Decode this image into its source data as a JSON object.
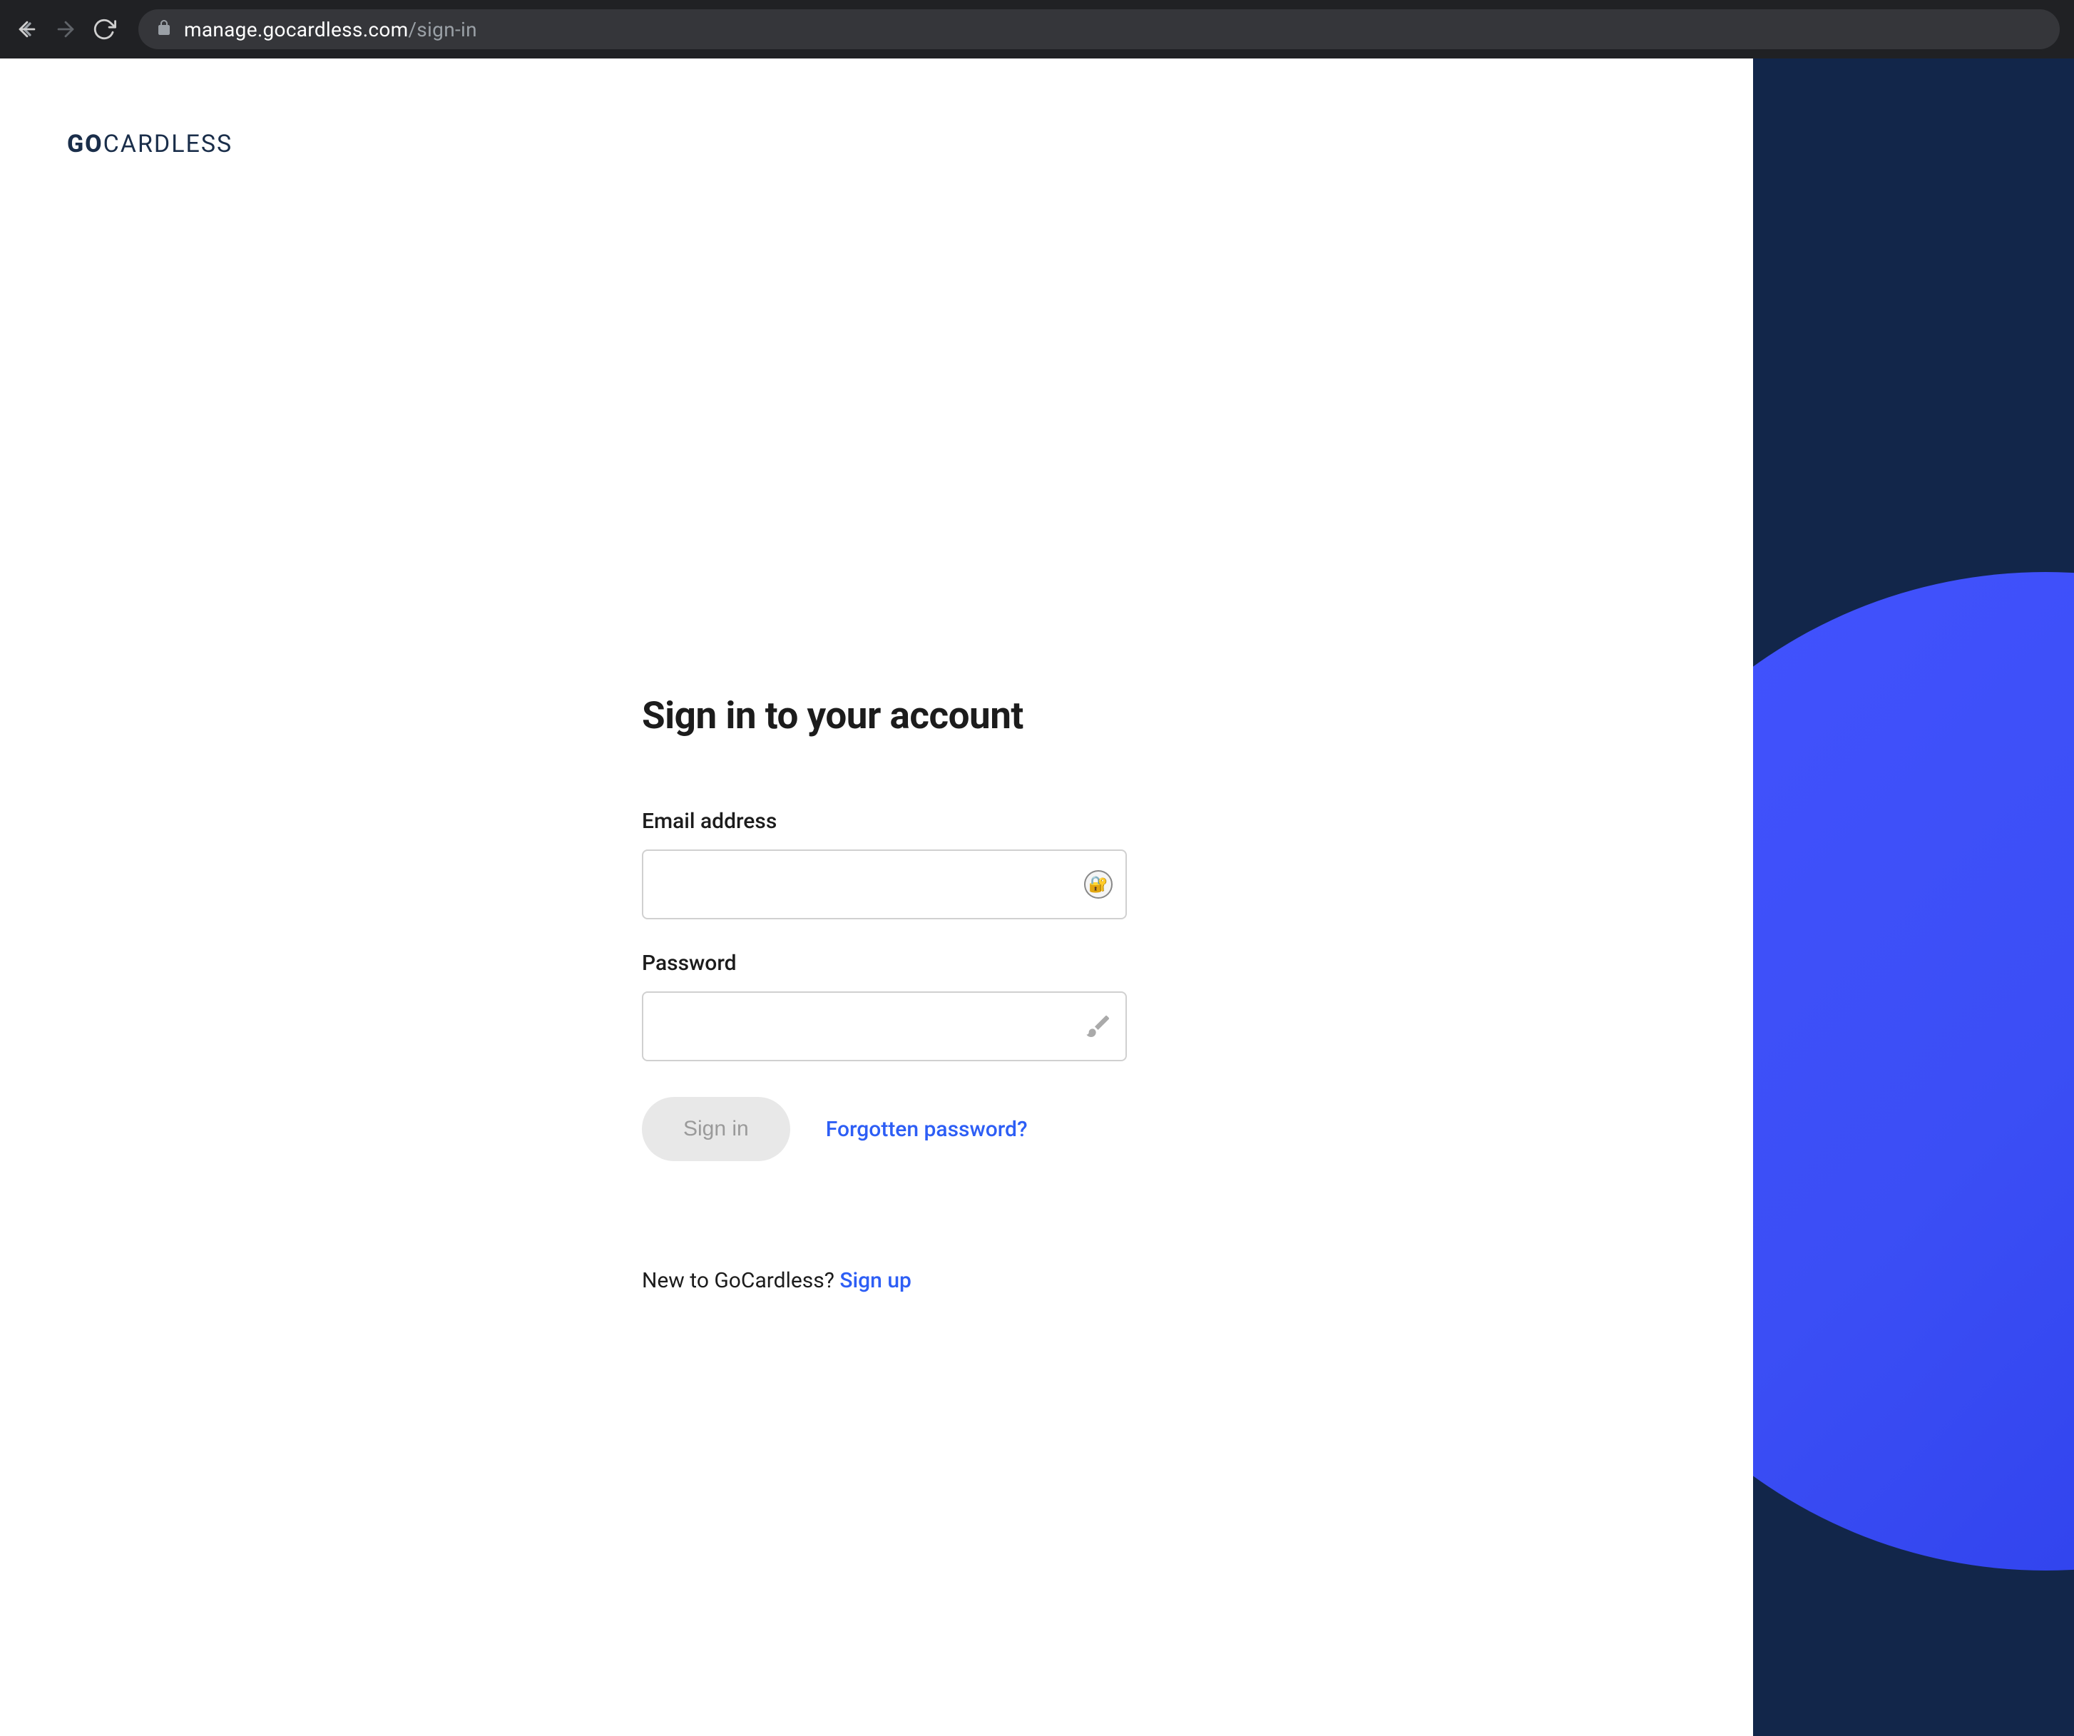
{
  "browser": {
    "url_domain": "manage.gocardless.com",
    "url_path": "/sign-in"
  },
  "logo": {
    "bold": "GO",
    "regular": "CARDLESS"
  },
  "form": {
    "title": "Sign in to your account",
    "email_label": "Email address",
    "email_value": "",
    "password_label": "Password",
    "password_value": "",
    "signin_button": "Sign in",
    "forgot_link": "Forgotten password?",
    "signup_prefix": "New to GoCardless? ",
    "signup_link": "Sign up"
  }
}
